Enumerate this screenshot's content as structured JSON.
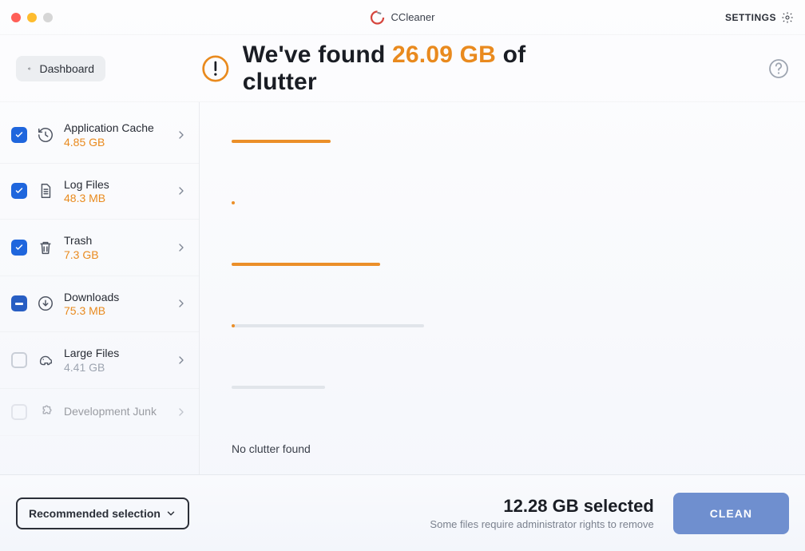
{
  "app": {
    "name": "CCleaner"
  },
  "header": {
    "settings_label": "SETTINGS",
    "dashboard_label": "Dashboard",
    "headline_prefix": "We've found ",
    "headline_amount": "26.09 GB",
    "headline_suffix": " of clutter"
  },
  "categories": [
    {
      "title": "Application Cache",
      "size": "4.85 GB",
      "check": "checked",
      "icon": "history-icon",
      "bar_selected_pct": 18,
      "bar_total_pct": 18
    },
    {
      "title": "Log Files",
      "size": "48.3 MB",
      "check": "checked",
      "icon": "file-text-icon",
      "bar_selected_pct": 0.6,
      "bar_total_pct": 0.6
    },
    {
      "title": "Trash",
      "size": "7.3 GB",
      "check": "checked",
      "icon": "trash-icon",
      "bar_selected_pct": 27,
      "bar_total_pct": 27
    },
    {
      "title": "Downloads",
      "size": "75.3 MB",
      "check": "indeterminate",
      "icon": "download-icon",
      "bar_selected_pct": 0.6,
      "bar_total_pct": 35
    },
    {
      "title": "Large Files",
      "size": "4.41 GB",
      "check": "unchecked",
      "icon": "elephant-icon",
      "bar_selected_pct": 0,
      "bar_total_pct": 17,
      "muted": true
    },
    {
      "title": "Development Junk",
      "size": "",
      "check": "unchecked",
      "icon": "puzzle-icon",
      "disabled": true,
      "no_data_label": "No clutter found"
    }
  ],
  "footer": {
    "recommended_label": "Recommended selection",
    "selected_amount": "12.28 GB selected",
    "admin_note": "Some files require administrator rights to remove",
    "clean_label": "CLEAN"
  }
}
